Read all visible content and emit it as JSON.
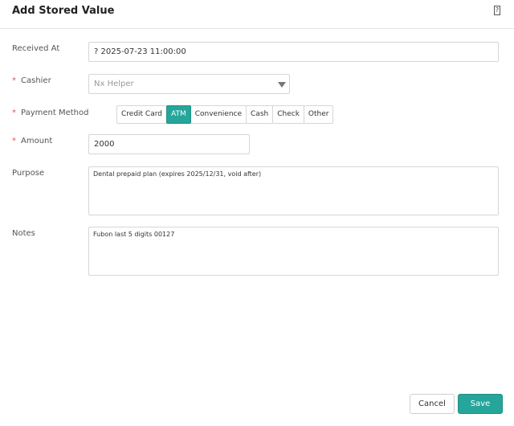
{
  "dialog": {
    "title": "Add Stored Value",
    "close_icon": "?"
  },
  "form": {
    "received_at": {
      "label": "Received At",
      "value": "2025-07-23 11:00:00",
      "icon": "?"
    },
    "cashier": {
      "label": "Cashier",
      "required_mark": "*",
      "placeholder": "Nx Helper"
    },
    "payment_method": {
      "label": "Payment Method",
      "required_mark": "*",
      "options": [
        "Credit Card",
        "ATM",
        "Convenience",
        "Cash",
        "Check",
        "Other"
      ],
      "selected": "ATM"
    },
    "amount": {
      "label": "Amount",
      "required_mark": "*",
      "value": "2000"
    },
    "purpose": {
      "label": "Purpose",
      "value": "Dental prepaid plan (expires 2025/12/31, void after)"
    },
    "notes": {
      "label": "Notes",
      "value": "Fubon last 5 digits 00127"
    }
  },
  "footer": {
    "cancel_label": "Cancel",
    "save_label": "Save"
  },
  "colors": {
    "accent": "#26a59a",
    "required": "#e05353"
  }
}
